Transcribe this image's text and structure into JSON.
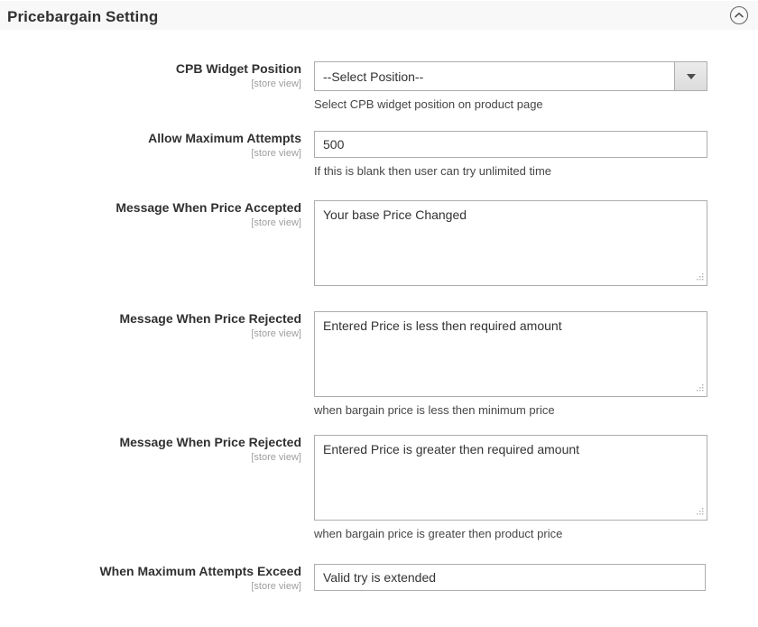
{
  "header": {
    "title": "Pricebargain Setting",
    "collapse_icon": "chevron-up-circle-icon"
  },
  "scope_note": "[store view]",
  "fields": [
    {
      "label": "CPB Widget Position",
      "scope": "[store view]",
      "type": "select",
      "value": "--Select Position--",
      "hint": "Select CPB widget position on product page",
      "name": "cpb-widget-position"
    },
    {
      "label": "Allow Maximum Attempts",
      "scope": "[store view]",
      "type": "text",
      "value": "500",
      "hint": "If this is blank then user can try unlimited time",
      "name": "allow-maximum-attempts"
    },
    {
      "label": "Message When Price Accepted",
      "scope": "[store view]",
      "type": "textarea",
      "value": "Your base Price Changed",
      "hint": "",
      "name": "message-when-price-accepted"
    },
    {
      "label": "Message When Price Rejected",
      "scope": "[store view]",
      "type": "textarea",
      "value": "Entered Price is less then required amount",
      "hint": "when bargain price is less then minimum price",
      "name": "message-when-price-rejected-low"
    },
    {
      "label": "Message When Price Rejected",
      "scope": "[store view]",
      "type": "textarea",
      "value": "Entered Price is greater then required amount",
      "hint": "when bargain price is greater then product price",
      "name": "message-when-price-rejected-high"
    },
    {
      "label": "When Maximum Attempts Exceed",
      "scope": "[store view]",
      "type": "text",
      "value": "Valid try is extended",
      "hint": "",
      "name": "when-maximum-attempts-exceed"
    }
  ],
  "colors": {
    "header_bg": "#f8f8f8",
    "title": "#303030",
    "label": "#303030",
    "scope": "#9e9e9e",
    "hint": "#464646",
    "input_border": "#adadad",
    "select_button": "#e3e3e3"
  }
}
